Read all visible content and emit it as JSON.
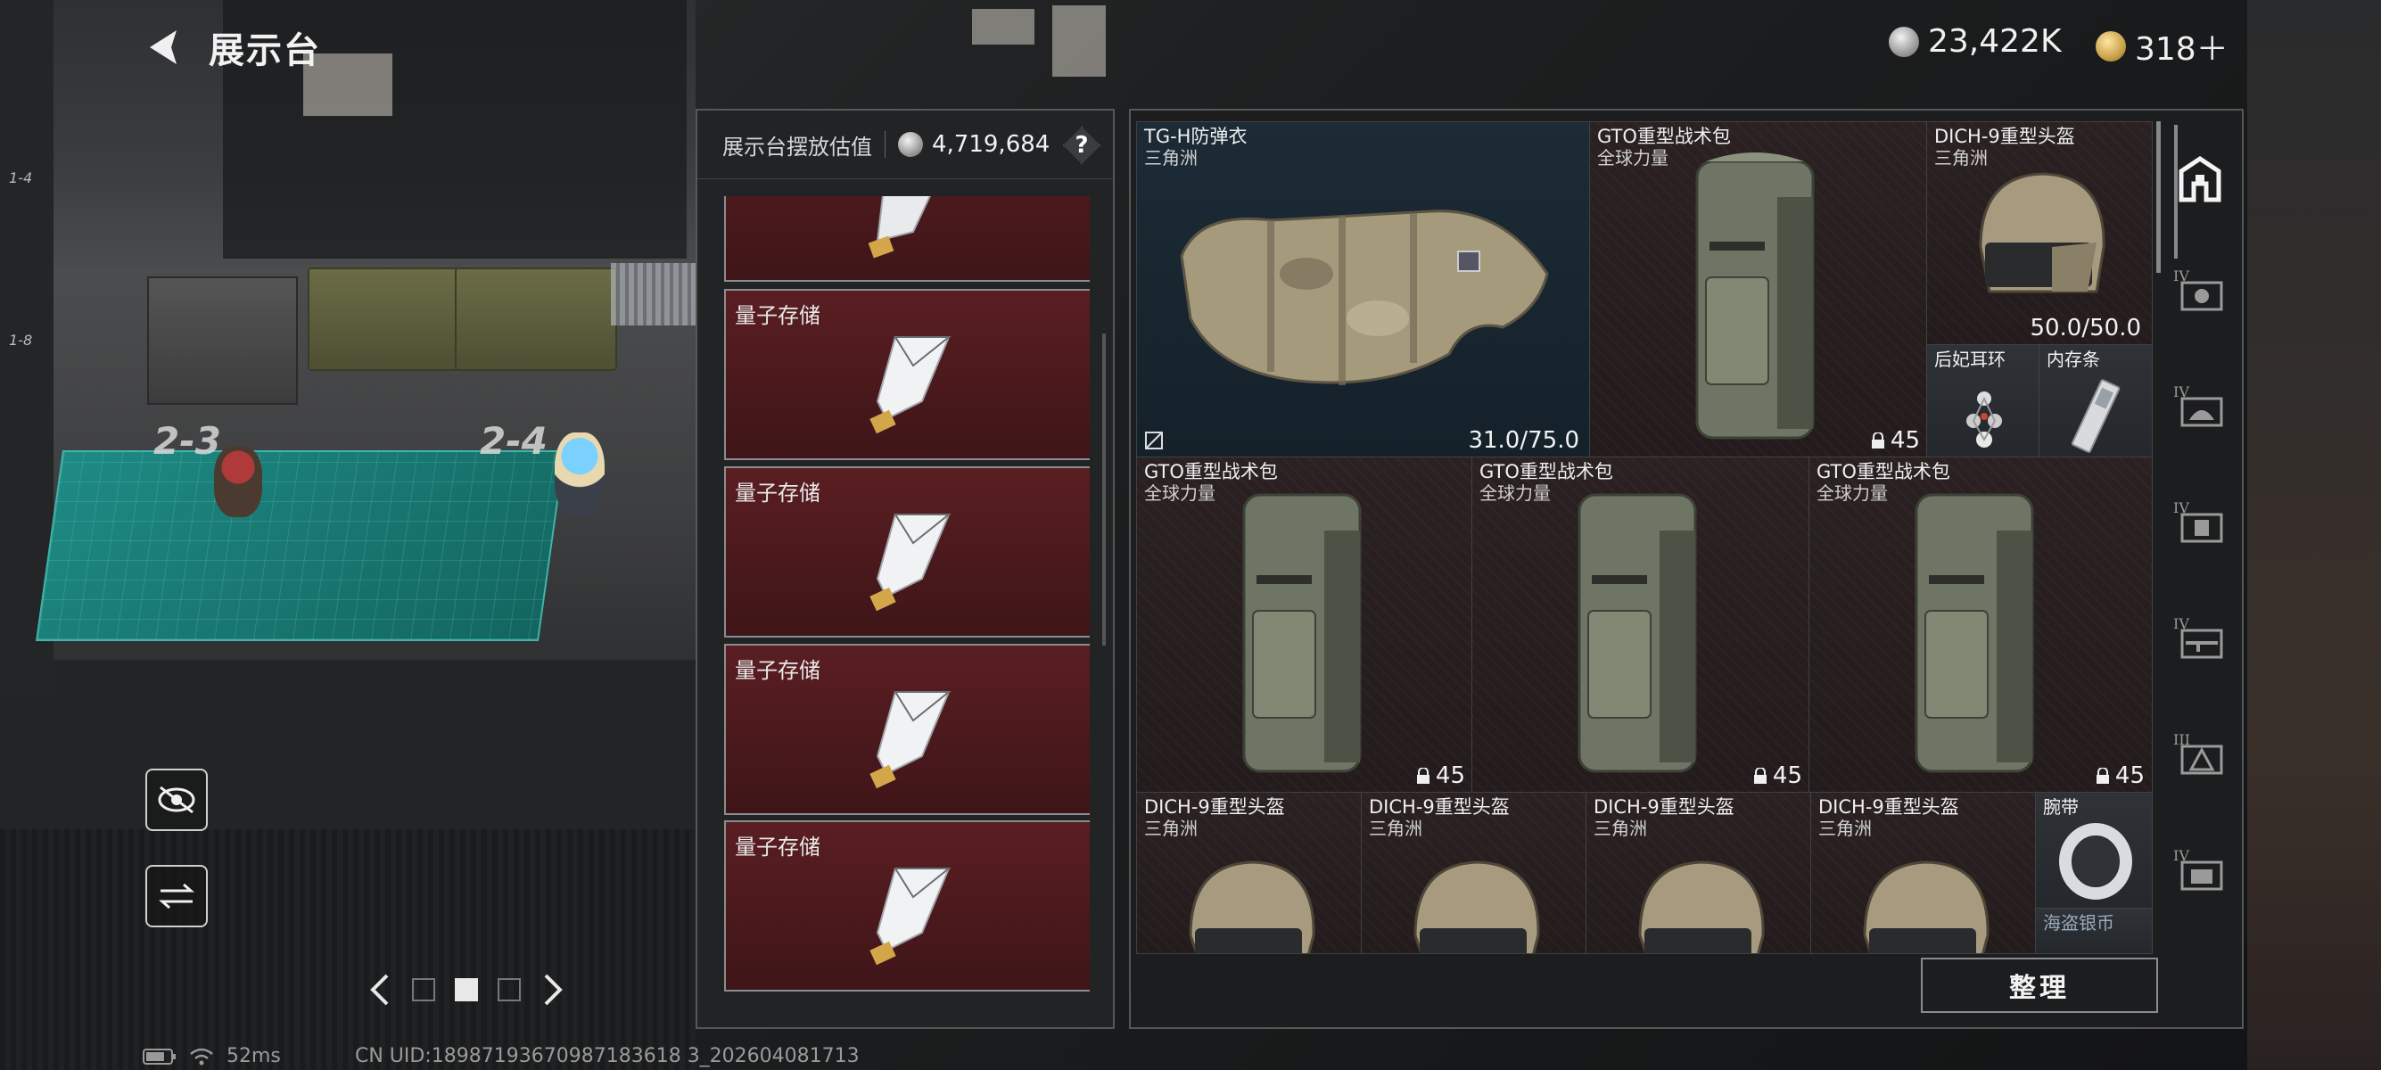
{
  "header": {
    "title": "展示台",
    "currency_silver": "23,422K",
    "currency_gold": "318＋"
  },
  "mid_panel": {
    "estimate_label": "展示台摆放估值",
    "estimate_value": "4,719,684",
    "help": "?",
    "items": [
      {
        "name": ""
      },
      {
        "name": "量子存储"
      },
      {
        "name": "量子存储"
      },
      {
        "name": "量子存储"
      },
      {
        "name": "量子存储"
      }
    ]
  },
  "grid": {
    "vest": {
      "name": "TG-H防弹衣",
      "source": "三角洲",
      "durability": "31.0/75.0"
    },
    "bag_top": {
      "name": "GTO重型战术包",
      "source": "全球力量",
      "capacity": "45"
    },
    "helmet_top": {
      "name": "DICH-9重型头盔",
      "source": "三角洲",
      "durability": "50.0/50.0"
    },
    "earring": {
      "name": "后妃耳环"
    },
    "memory": {
      "name": "内存条"
    },
    "bags_row": [
      {
        "name": "GTO重型战术包",
        "source": "全球力量",
        "capacity": "45"
      },
      {
        "name": "GTO重型战术包",
        "source": "全球力量",
        "capacity": "45"
      },
      {
        "name": "GTO重型战术包",
        "source": "全球力量",
        "capacity": "45"
      }
    ],
    "helmets_row": [
      {
        "name": "DICH-9重型头盔",
        "source": "三角洲"
      },
      {
        "name": "DICH-9重型头盔",
        "source": "三角洲"
      },
      {
        "name": "DICH-9重型头盔",
        "source": "三角洲"
      },
      {
        "name": "DICH-9重型头盔",
        "source": "三角洲"
      }
    ],
    "wristband": {
      "name": "腕带"
    },
    "coin": {
      "name": "海盗银币"
    }
  },
  "sort_button": "整理",
  "scene": {
    "slot_a": "2-3",
    "slot_b": "2-4",
    "shelf_a": "1-4",
    "shelf_b": "1-8"
  },
  "rail": {
    "tier_a": "IV",
    "tier_b": "IV",
    "tier_c": "IV",
    "tier_d": "IV",
    "tier_e": "III",
    "tier_f": "IV"
  },
  "status": {
    "ping": "52ms",
    "uid": "CN UID:18987193670987183618 3_202604081713"
  },
  "colors": {
    "card_red": "#4a181b",
    "cell_blue": "#1c2b36",
    "mat_teal": "#1f8a84",
    "gold": "#c9a14a"
  }
}
